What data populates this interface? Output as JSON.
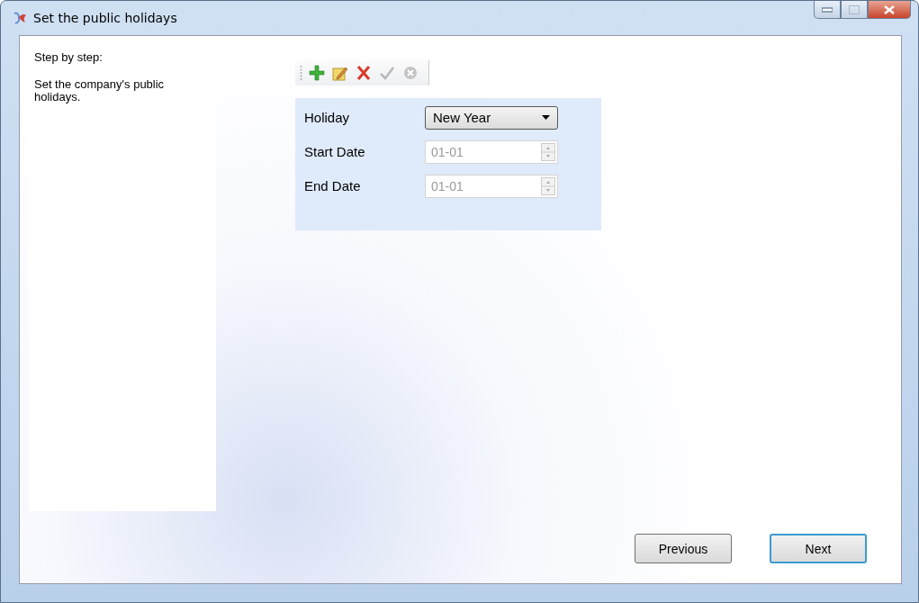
{
  "window": {
    "title": "Set the public holidays"
  },
  "sidebar": {
    "heading": "Step by step:",
    "description": "Set the company's public holidays."
  },
  "toolbar": [
    {
      "kind": "add",
      "disabled": false
    },
    {
      "kind": "edit",
      "disabled": false
    },
    {
      "kind": "delete",
      "disabled": false
    },
    {
      "kind": "confirm",
      "disabled": true
    },
    {
      "kind": "cancel",
      "disabled": true
    }
  ],
  "form": {
    "fields": [
      {
        "kind": "dropdown",
        "label": "Holiday",
        "value": "New Year",
        "disabled": false
      },
      {
        "kind": "spinner",
        "label": "Start Date",
        "value": "01-01",
        "disabled": true
      },
      {
        "kind": "spinner",
        "label": "End Date",
        "value": "01-01",
        "disabled": true
      }
    ]
  },
  "buttons": [
    {
      "label": "Previous",
      "focused": false
    },
    {
      "label": "Next",
      "focused": true
    }
  ]
}
